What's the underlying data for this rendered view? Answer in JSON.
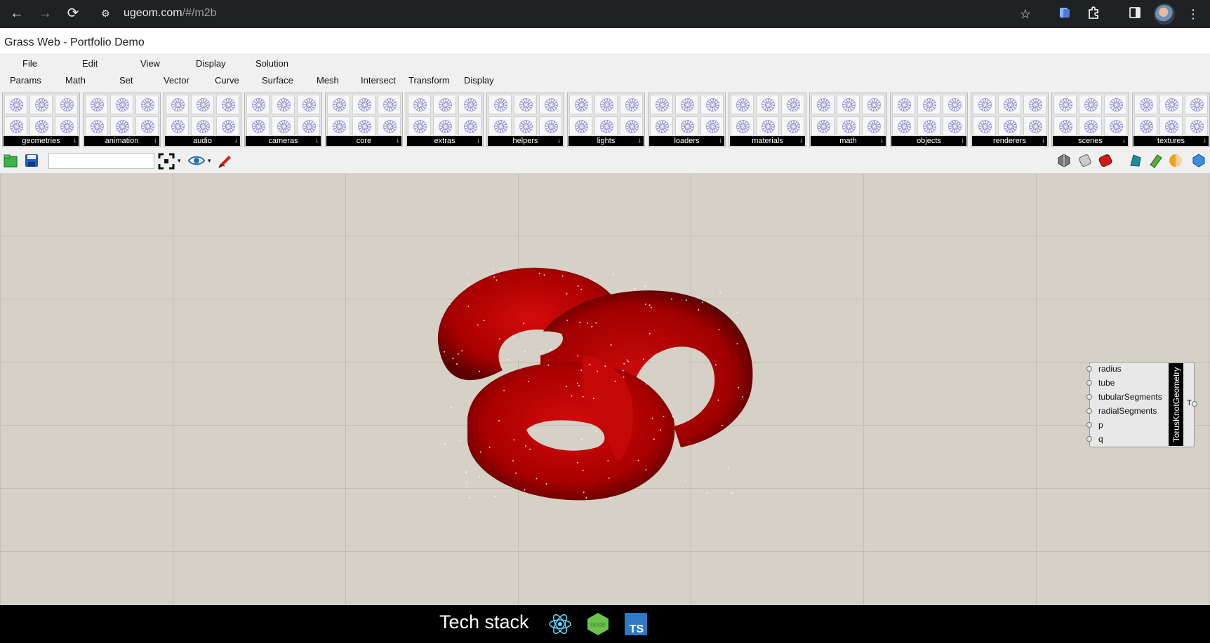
{
  "browser": {
    "url_host": "ugeom.com",
    "url_path": "/#/m2b"
  },
  "app": {
    "title": "Grass Web - Portfolio Demo"
  },
  "menus": {
    "top": [
      "File",
      "Edit",
      "View",
      "Display",
      "Solution"
    ],
    "sub": [
      "Params",
      "Math",
      "Set",
      "Vector",
      "Curve",
      "Surface",
      "Mesh",
      "Intersect",
      "Transform",
      "Display"
    ]
  },
  "ribbon": {
    "groups": [
      "geometries",
      "animation",
      "audio",
      "cameras",
      "core",
      "extras",
      "helpers",
      "lights",
      "loaders",
      "materials",
      "math",
      "objects",
      "renderers",
      "scenes",
      "textures"
    ],
    "arrow": "↓"
  },
  "toolbar": {
    "search_value": ""
  },
  "node": {
    "name": "TorusKnotGeometry",
    "inputs": [
      "radius",
      "tube",
      "tubularSegments",
      "radialSegments",
      "p",
      "q"
    ],
    "output": "T"
  },
  "footer": {
    "label": "Tech stack",
    "ts_badge": "TS",
    "icons": [
      "react-icon",
      "nodejs-icon",
      "typescript-icon"
    ]
  },
  "colors": {
    "knot": "#b00000",
    "canvas": "#d6d1c7",
    "chrome": "#202124"
  }
}
